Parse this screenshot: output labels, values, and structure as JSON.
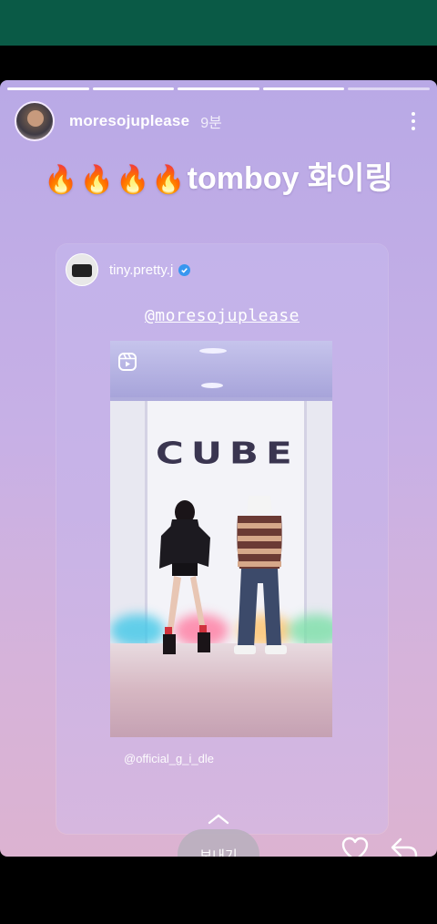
{
  "story": {
    "username": "moresojuplease",
    "time_ago": "9분",
    "caption_emoji": "🔥🔥🔥🔥",
    "caption_text": "tomboy 화이링",
    "progress_segments": 5,
    "progress_completed": 4
  },
  "shared_post": {
    "author": "tiny.pretty.j",
    "mention": "@moresojuplease",
    "video_sign": "CUBE",
    "watermark": "@official_g_i_dle"
  },
  "actions": {
    "send_label": "보내기"
  },
  "colors": {
    "status_bar": "#0a5a46",
    "verified": "#3897f0"
  }
}
